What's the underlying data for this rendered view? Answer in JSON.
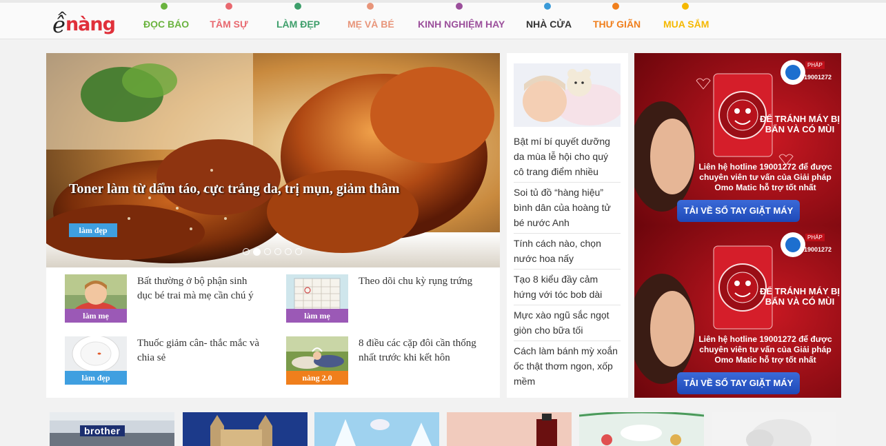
{
  "header": {
    "logo": {
      "e": "ê",
      "rest": "nàng"
    },
    "nav": [
      {
        "label": "ĐỌC BÁO",
        "color": "#6ab33e"
      },
      {
        "label": "TÂM SỰ",
        "color": "#e8686f"
      },
      {
        "label": "LÀM ĐẸP",
        "color": "#3d9e6a"
      },
      {
        "label": "MẸ VÀ BÉ",
        "color": "#e8957a"
      },
      {
        "label": "KINH NGHIỆM HAY",
        "color": "#9b4f9b"
      },
      {
        "label": "NHÀ CỬA",
        "color": "#333333",
        "dot": "#3a9ad8"
      },
      {
        "label": "THƯ GIÃN",
        "color": "#f07f1c"
      },
      {
        "label": "MUA SẮM",
        "color": "#f5b800"
      }
    ]
  },
  "hero": {
    "title": "Toner làm từ dấm táo, cực trắng da, trị mụn, giảm thâm",
    "tag": "làm đẹp",
    "slide_count": 6,
    "active_slide": 2
  },
  "articles": [
    {
      "title": "Bất thường ở bộ phận sinh dục bé trai mà mẹ cần chú ý",
      "tag": "làm mẹ",
      "tag_color": "#9b59b6"
    },
    {
      "title": "Theo dõi chu kỳ rụng trứng",
      "tag": "làm mẹ",
      "tag_color": "#9b59b6"
    },
    {
      "title": "Thuốc giảm cân- thắc mắc và chia sẻ",
      "tag": "làm đẹp",
      "tag_color": "#3f9fe0"
    },
    {
      "title": "8 điều các cặp đôi cần thống nhất trước khi kết hôn",
      "tag": "nàng 2.0",
      "tag_color": "#f07f1c"
    }
  ],
  "side_list": [
    "Bật mí bí quyết dưỡng da mùa lễ hội cho quý cô trang điểm nhiều",
    "Soi tủ đồ “hàng hiệu” bình dân của hoàng tử bé nước Anh",
    "Tính cách nào, chọn nước hoa nấy",
    "Tạo 8 kiểu đầy cảm hứng với tóc bob dài",
    "Mực xào ngũ sắc ngọt giòn cho bữa tối",
    "Cách làm bánh mỳ xoắn ốc thật thơm ngon, xốp mềm"
  ],
  "ad": {
    "phap": "PHÁP",
    "hotline_num": "19001272",
    "headline": "ĐỂ TRÁNH MÁY BỊ BẨN VÀ CÓ MÙI",
    "contact": "Liên hệ hotline 19001272 để được chuyên viên tư vấn của Giải pháp Omo Matic hỗ trợ tốt nhất",
    "button": "TẢI VỀ SỔ TAY GIẶT MÁY"
  },
  "bottom": {
    "brother_label": "brother"
  }
}
